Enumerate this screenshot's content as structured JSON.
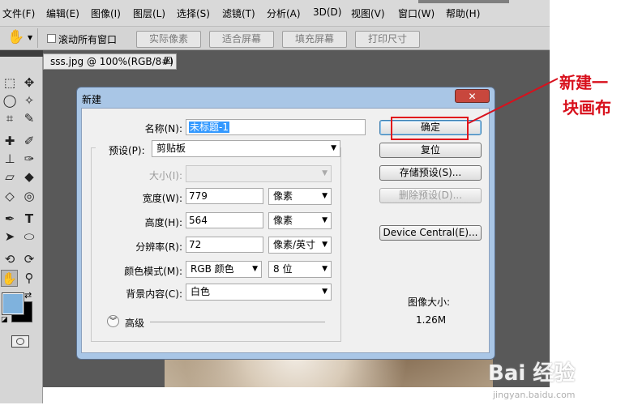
{
  "menubar": {
    "items": [
      "文件(F)",
      "编辑(E)",
      "图像(I)",
      "图层(L)",
      "选择(S)",
      "滤镜(T)",
      "分析(A)",
      "3D(D)",
      "视图(V)",
      "窗口(W)",
      "帮助(H)"
    ]
  },
  "optionsbar": {
    "scroll_all_label": "滚动所有窗口",
    "actual_pixels": "实际像素",
    "fit_screen": "适合屏幕",
    "fill_screen": "填充屏幕",
    "print_size": "打印尺寸"
  },
  "document_tab": {
    "title": "sss.jpg @ 100%(RGB/8#)",
    "close": "☒"
  },
  "dialog": {
    "title": "新建",
    "close": "✕",
    "name_label": "名称(N):",
    "name_value": "未标题-1",
    "preset_label": "预设(P):",
    "preset_value": "剪贴板",
    "size_label": "大小(I):",
    "width_label": "宽度(W):",
    "width_value": "779",
    "width_unit": "像素",
    "height_label": "高度(H):",
    "height_value": "564",
    "height_unit": "像素",
    "resolution_label": "分辨率(R):",
    "resolution_value": "72",
    "resolution_unit": "像素/英寸",
    "color_mode_label": "颜色模式(M):",
    "color_mode_value": "RGB 颜色",
    "bit_depth_value": "8 位",
    "background_label": "背景内容(C):",
    "background_value": "白色",
    "advanced_label": "高级",
    "ok_button": "确定",
    "reset_button": "复位",
    "save_preset_button": "存储预设(S)...",
    "delete_preset_button": "删除预设(D)...",
    "device_central_button": "Device Central(E)...",
    "image_size_label": "图像大小:",
    "image_size_value": "1.26M"
  },
  "annotation": {
    "line1": "新建一",
    "line2": "块画布",
    "color": "#d8101c"
  },
  "watermark": {
    "brand": "Bai 经验",
    "url": "jingyan.baidu.com"
  }
}
